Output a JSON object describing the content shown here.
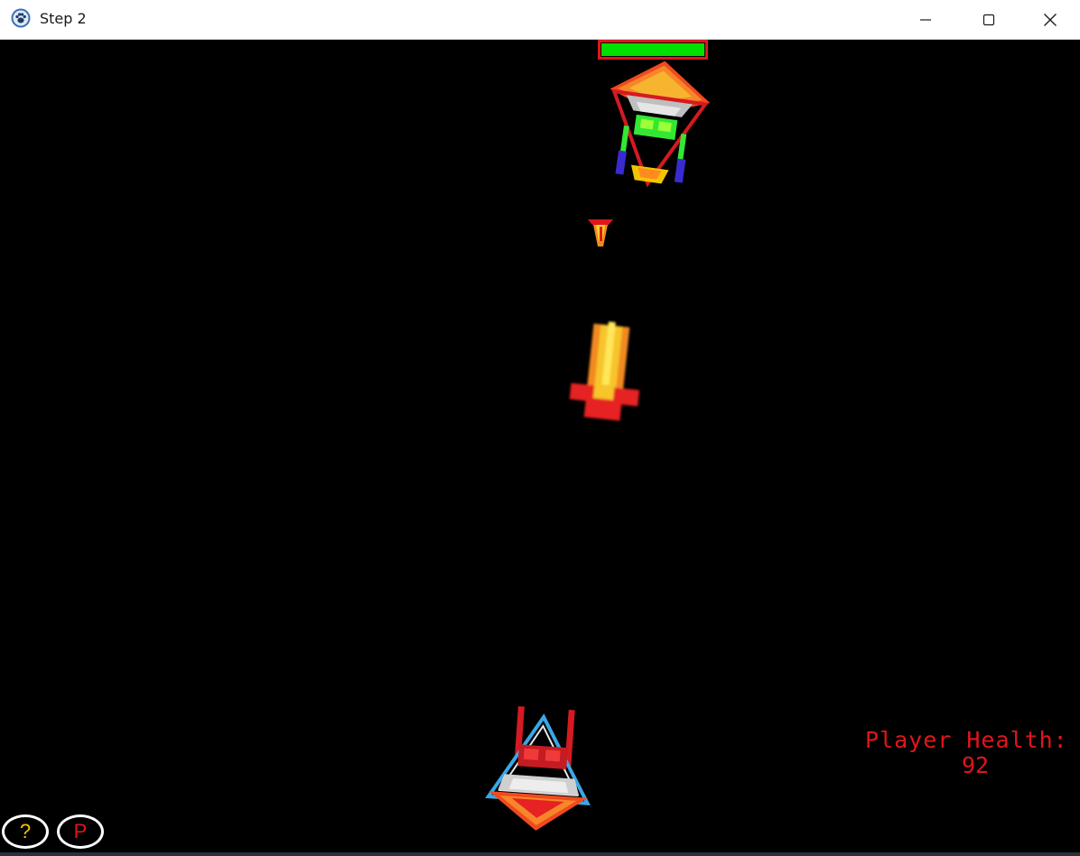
{
  "window": {
    "title": "Step 2",
    "icon": "paw-icon",
    "controls": [
      "minimize-icon",
      "maximize-icon",
      "close-icon"
    ]
  },
  "hud": {
    "player_health_label": "Player Health:",
    "player_health_value": "92",
    "enemy_health_fraction": 1.0,
    "help_button_label": "?",
    "pause_button_label": "P"
  },
  "colors": {
    "background": "#000000",
    "health_text": "#e0161b",
    "enemy_health_fill": "#00e000",
    "enemy_health_border": "#e0161b",
    "help_label": "#f2c500",
    "pause_label": "#e0161b"
  }
}
